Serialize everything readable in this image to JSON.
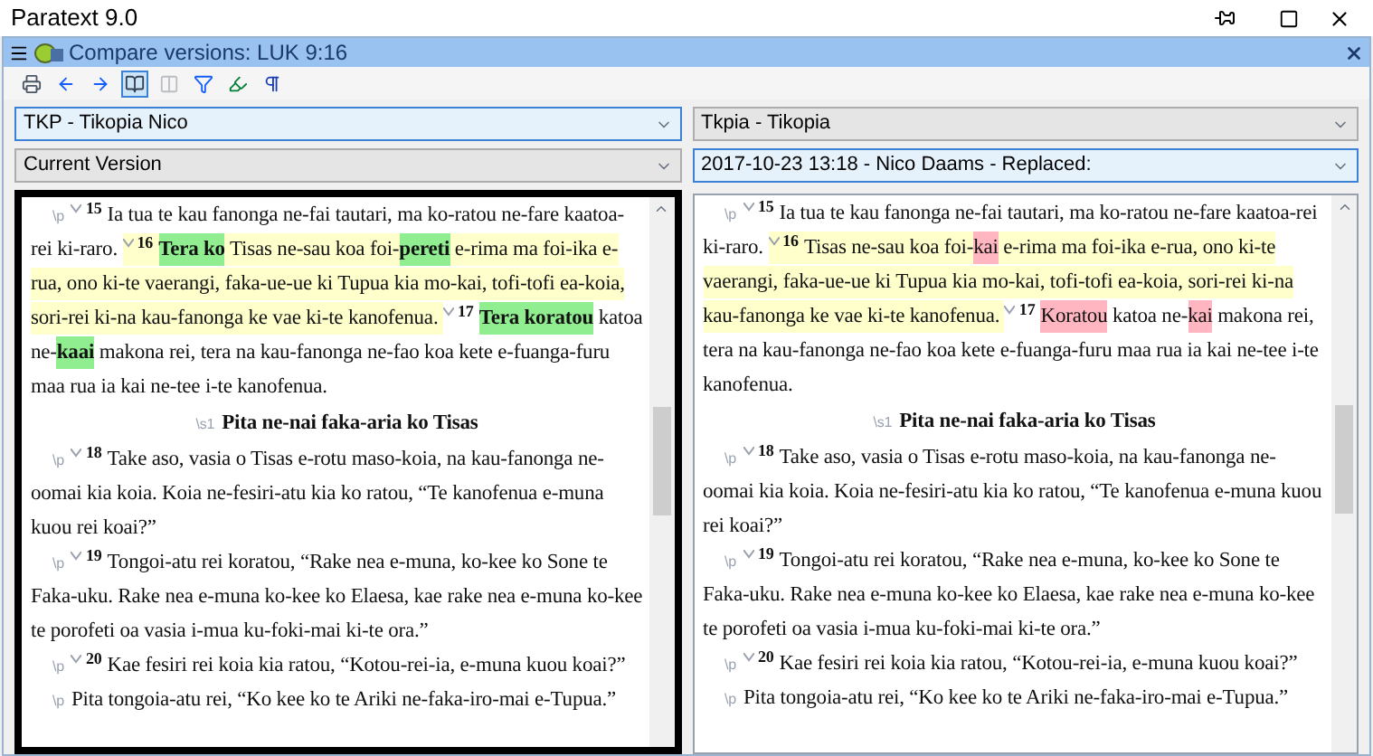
{
  "window": {
    "title": "Paratext 9.0"
  },
  "panel": {
    "title": "Compare versions: LUK 9:16"
  },
  "toolbar": [
    {
      "kind": "print",
      "pressed": false,
      "disabled": false
    },
    {
      "kind": "back",
      "pressed": false,
      "disabled": false
    },
    {
      "kind": "forward",
      "pressed": false,
      "disabled": false
    },
    {
      "kind": "book",
      "pressed": true,
      "disabled": false
    },
    {
      "kind": "columns",
      "pressed": false,
      "disabled": true
    },
    {
      "kind": "filter",
      "pressed": false,
      "disabled": false
    },
    {
      "kind": "highlight",
      "pressed": false,
      "disabled": false
    },
    {
      "kind": "pilcrow",
      "pressed": false,
      "disabled": false
    }
  ],
  "panes": [
    {
      "kind": "current",
      "active": true,
      "selectors": [
        {
          "value": "TKP -  Tikopia Nico",
          "focused": true
        },
        {
          "value": "Current Version",
          "focused": false
        }
      ],
      "paragraphs": [
        {
          "kind": "p",
          "marker": "\\p",
          "verses": [
            {
              "number": "15",
              "current": false,
              "spans": [
                {
                  "text": "Ia tua te kau fanonga ne-fai tautari, ma ko-ratou ne-fare kaatoa-rei ki-raro.",
                  "changed": false
                }
              ]
            },
            {
              "number": "16",
              "current": true,
              "spans": [
                {
                  "text": "Tera ko",
                  "changed": true
                },
                {
                  "text": " Tisas ne-sau koa foi-",
                  "changed": false
                },
                {
                  "text": "pereti",
                  "changed": true
                },
                {
                  "text": " e-rima ma foi-ika e-rua, ono ki-te vaerangi, faka-ue-ue ki Tupua kia mo-kai, tofi-tofi ea-koia, sori-rei ki-na kau-fanonga ke vae ki-te kanofenua.",
                  "changed": false
                }
              ]
            },
            {
              "number": "17",
              "current": false,
              "spans": [
                {
                  "text": "Tera koratou",
                  "changed": true
                },
                {
                  "text": " katoa ne-",
                  "changed": false
                },
                {
                  "text": "kaai",
                  "changed": true
                },
                {
                  "text": " makona rei, tera na kau-fanonga ne-fao koa kete e-fuanga-furu maa rua ia kai ne-tee i-te kanofenua.",
                  "changed": false
                }
              ]
            }
          ]
        },
        {
          "kind": "heading",
          "marker": "\\s1",
          "text": "Pita ne-nai faka-aria ko Tisas"
        },
        {
          "kind": "p",
          "marker": "\\p",
          "verses": [
            {
              "number": "18",
              "current": false,
              "spans": [
                {
                  "text": "Take aso, vasia o Tisas e-rotu maso-koia, na kau-fanonga ne-oomai kia koia. Koia ne-fesiri-atu kia ko ratou, “Te kanofenua e-muna kuou rei koai?”",
                  "changed": false
                }
              ]
            }
          ]
        },
        {
          "kind": "p",
          "marker": "\\p",
          "verses": [
            {
              "number": "19",
              "current": false,
              "spans": [
                {
                  "text": "Tongoi-atu rei koratou, “Rake nea e-muna, ko-kee ko Sone te Faka-uku. Rake nea e-muna ko-kee ko Elaesa, kae rake nea e-muna ko-kee te porofeti oa vasia i-mua ku-foki-mai ki-te ora.”",
                  "changed": false
                }
              ]
            }
          ]
        },
        {
          "kind": "p",
          "marker": "\\p",
          "verses": [
            {
              "number": "20",
              "current": false,
              "spans": [
                {
                  "text": "Kae fesiri rei koia kia ratou, “Kotou-rei-ia, e-muna kuou koai?”",
                  "changed": false
                }
              ]
            }
          ]
        },
        {
          "kind": "p",
          "marker": "\\p",
          "verses": [
            {
              "current": false,
              "spans": [
                {
                  "text": "Pita tongoia-atu rei, “Ko kee ko te Ariki ne-faka-iro-mai e-Tupua.”",
                  "changed": false
                }
              ]
            }
          ]
        }
      ]
    },
    {
      "kind": "revision",
      "active": false,
      "selectors": [
        {
          "value": "Tkpia -  Tikopia",
          "focused": false
        },
        {
          "value": "2017-10-23 13:18 - Nico Daams - Replaced:",
          "focused": true
        }
      ],
      "paragraphs": [
        {
          "kind": "p",
          "marker": "\\p",
          "verses": [
            {
              "number": "15",
              "current": false,
              "spans": [
                {
                  "text": "Ia tua te kau fanonga ne-fai tautari, ma ko-ratou ne-fare kaatoa-rei ki-raro.",
                  "changed": false
                }
              ]
            },
            {
              "number": "16",
              "current": true,
              "spans": [
                {
                  "text": "Tisas ne-sau koa foi-",
                  "changed": false
                },
                {
                  "text": "kai",
                  "changed": true
                },
                {
                  "text": " e-rima ma foi-ika e-rua, ono ki-te vaerangi, faka-ue-ue ki Tupua kia mo-kai, tofi-tofi ea-koia, sori-rei ki-na kau-fanonga ke vae ki-te kanofenua.",
                  "changed": false
                }
              ]
            },
            {
              "number": "17",
              "current": false,
              "spans": [
                {
                  "text": "Koratou",
                  "changed": true
                },
                {
                  "text": " katoa ne-",
                  "changed": false
                },
                {
                  "text": "kai",
                  "changed": true
                },
                {
                  "text": " makona rei, tera na kau-fanonga ne-fao koa kete e-fuanga-furu maa rua ia kai ne-tee i-te kanofenua.",
                  "changed": false
                }
              ]
            }
          ]
        },
        {
          "kind": "heading",
          "marker": "\\s1",
          "text": "Pita ne-nai faka-aria ko Tisas"
        },
        {
          "kind": "p",
          "marker": "\\p",
          "verses": [
            {
              "number": "18",
              "current": false,
              "spans": [
                {
                  "text": "Take aso, vasia o Tisas e-rotu maso-koia, na kau-fanonga ne-oomai kia koia. Koia ne-fesiri-atu kia ko ratou, “Te kanofenua e-muna kuou rei koai?”",
                  "changed": false
                }
              ]
            }
          ]
        },
        {
          "kind": "p",
          "marker": "\\p",
          "verses": [
            {
              "number": "19",
              "current": false,
              "spans": [
                {
                  "text": "Tongoi-atu rei koratou, “Rake nea e-muna, ko-kee ko Sone te Faka-uku. Rake nea e-muna ko-kee ko Elaesa, kae rake nea e-muna ko-kee te porofeti oa vasia i-mua ku-foki-mai ki-te ora.”",
                  "changed": false
                }
              ]
            }
          ]
        },
        {
          "kind": "p",
          "marker": "\\p",
          "verses": [
            {
              "number": "20",
              "current": false,
              "spans": [
                {
                  "text": "Kae fesiri rei koia kia ratou, “Kotou-rei-ia, e-muna kuou koai?”",
                  "changed": false
                }
              ]
            }
          ]
        },
        {
          "kind": "p",
          "marker": "\\p",
          "verses": [
            {
              "current": false,
              "spans": [
                {
                  "text": "Pita tongoia-atu rei, “Ko kee ko te Ariki ne-faka-iro-mai e-Tupua.”",
                  "changed": false
                }
              ]
            }
          ]
        }
      ]
    }
  ]
}
